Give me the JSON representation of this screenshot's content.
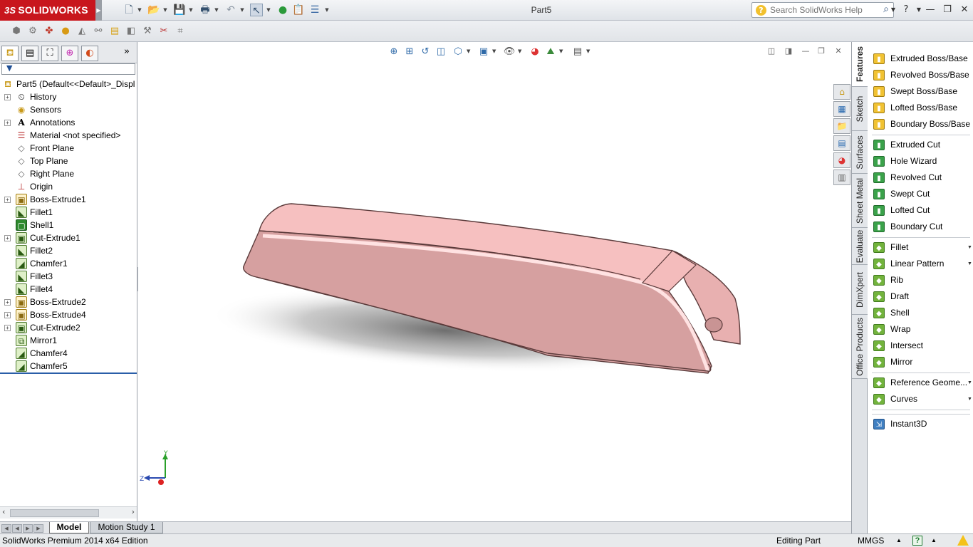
{
  "app": {
    "brand": "SOLIDWORKS",
    "brand_prefix": "3S",
    "document_title": "Part5"
  },
  "search": {
    "placeholder": "Search SolidWorks Help"
  },
  "quick_access": [
    "new-icon",
    "open-icon",
    "save-icon",
    "print-icon",
    "undo-icon",
    "select-icon",
    "rebuild-icon",
    "file-properties-icon",
    "options-icon"
  ],
  "feature_manager": {
    "tabs": [
      "featuremanager-tab-icon",
      "propertymanager-tab-icon",
      "configurationmanager-tab-icon",
      "dimxpertmanager-tab-icon",
      "displaymanager-tab-icon"
    ],
    "root": "Part5  (Default<<Default>_Displ",
    "items": [
      {
        "label": "History",
        "icon": "history-icon",
        "expandable": true
      },
      {
        "label": "Sensors",
        "icon": "sensors-icon",
        "expandable": false
      },
      {
        "label": "Annotations",
        "icon": "annotations-icon",
        "expandable": true
      },
      {
        "label": "Material <not specified>",
        "icon": "material-icon",
        "expandable": false
      },
      {
        "label": "Front Plane",
        "icon": "plane-icon",
        "expandable": false
      },
      {
        "label": "Top Plane",
        "icon": "plane-icon",
        "expandable": false
      },
      {
        "label": "Right Plane",
        "icon": "plane-icon",
        "expandable": false
      },
      {
        "label": "Origin",
        "icon": "origin-icon",
        "expandable": false
      },
      {
        "label": "Boss-Extrude1",
        "icon": "extrude-icon",
        "expandable": true
      },
      {
        "label": "Fillet1",
        "icon": "fillet-icon",
        "expandable": false
      },
      {
        "label": "Shell1",
        "icon": "shell-icon",
        "expandable": false
      },
      {
        "label": "Cut-Extrude1",
        "icon": "cut-extrude-icon",
        "expandable": true
      },
      {
        "label": "Fillet2",
        "icon": "fillet-icon",
        "expandable": false
      },
      {
        "label": "Chamfer1",
        "icon": "chamfer-icon",
        "expandable": false
      },
      {
        "label": "Fillet3",
        "icon": "fillet-icon",
        "expandable": false
      },
      {
        "label": "Fillet4",
        "icon": "fillet-icon",
        "expandable": false
      },
      {
        "label": "Boss-Extrude2",
        "icon": "extrude-icon",
        "expandable": true
      },
      {
        "label": "Boss-Extrude4",
        "icon": "extrude-icon",
        "expandable": true
      },
      {
        "label": "Cut-Extrude2",
        "icon": "cut-extrude-icon",
        "expandable": true
      },
      {
        "label": "Mirror1",
        "icon": "mirror-icon",
        "expandable": false
      },
      {
        "label": "Chamfer4",
        "icon": "chamfer-icon",
        "expandable": false
      },
      {
        "label": "Chamfer5",
        "icon": "chamfer-icon",
        "expandable": false
      }
    ]
  },
  "bottom_tabs": {
    "model": "Model",
    "motion": "Motion Study 1"
  },
  "status": {
    "left": "SolidWorks Premium 2014 x64 Edition",
    "mode": "Editing Part",
    "units": "MMGS",
    "help": "?"
  },
  "command_tabs": [
    "Features",
    "Sketch",
    "Surfaces",
    "Sheet Metal",
    "Evaluate",
    "DimXpert",
    "Office Products"
  ],
  "commands": [
    {
      "label": "Extruded Boss/Base",
      "icon": "extruded-boss-icon",
      "kind": "boss",
      "dropdown": false
    },
    {
      "label": "Revolved Boss/Base",
      "icon": "revolved-boss-icon",
      "kind": "boss",
      "dropdown": false
    },
    {
      "label": "Swept Boss/Base",
      "icon": "swept-boss-icon",
      "kind": "boss",
      "dropdown": false
    },
    {
      "label": "Lofted Boss/Base",
      "icon": "lofted-boss-icon",
      "kind": "boss",
      "dropdown": false
    },
    {
      "label": "Boundary Boss/Base",
      "icon": "boundary-boss-icon",
      "kind": "boss",
      "dropdown": false
    },
    {
      "label": "Extruded Cut",
      "icon": "extruded-cut-icon",
      "kind": "cut",
      "dropdown": false
    },
    {
      "label": "Hole Wizard",
      "icon": "hole-wizard-icon",
      "kind": "cut",
      "dropdown": false
    },
    {
      "label": "Revolved Cut",
      "icon": "revolved-cut-icon",
      "kind": "cut",
      "dropdown": false
    },
    {
      "label": "Swept Cut",
      "icon": "swept-cut-icon",
      "kind": "cut",
      "dropdown": false
    },
    {
      "label": "Lofted Cut",
      "icon": "lofted-cut-icon",
      "kind": "cut",
      "dropdown": false
    },
    {
      "label": "Boundary Cut",
      "icon": "boundary-cut-icon",
      "kind": "cut",
      "dropdown": false
    },
    {
      "label": "Fillet",
      "icon": "fillet-icon",
      "kind": "green",
      "dropdown": true
    },
    {
      "label": "Linear Pattern",
      "icon": "linear-pattern-icon",
      "kind": "green",
      "dropdown": true
    },
    {
      "label": "Rib",
      "icon": "rib-icon",
      "kind": "green",
      "dropdown": false
    },
    {
      "label": "Draft",
      "icon": "draft-icon",
      "kind": "green",
      "dropdown": false
    },
    {
      "label": "Shell",
      "icon": "shell-icon",
      "kind": "green",
      "dropdown": false
    },
    {
      "label": "Wrap",
      "icon": "wrap-icon",
      "kind": "green",
      "dropdown": false
    },
    {
      "label": "Intersect",
      "icon": "intersect-icon",
      "kind": "green",
      "dropdown": false
    },
    {
      "label": "Mirror",
      "icon": "mirror-icon",
      "kind": "green",
      "dropdown": false
    },
    {
      "label": "Reference Geome...",
      "icon": "reference-geometry-icon",
      "kind": "green",
      "dropdown": true
    },
    {
      "label": "Curves",
      "icon": "curves-icon",
      "kind": "green",
      "dropdown": true
    },
    {
      "label": "Instant3D",
      "icon": "instant3d-icon",
      "kind": "blue",
      "dropdown": false
    }
  ],
  "triad": {
    "y": "Y",
    "z": "Z"
  },
  "colors": {
    "model_face": "#f4bcbc",
    "model_side": "#d9a0a0",
    "brand_red": "#c8161d"
  }
}
